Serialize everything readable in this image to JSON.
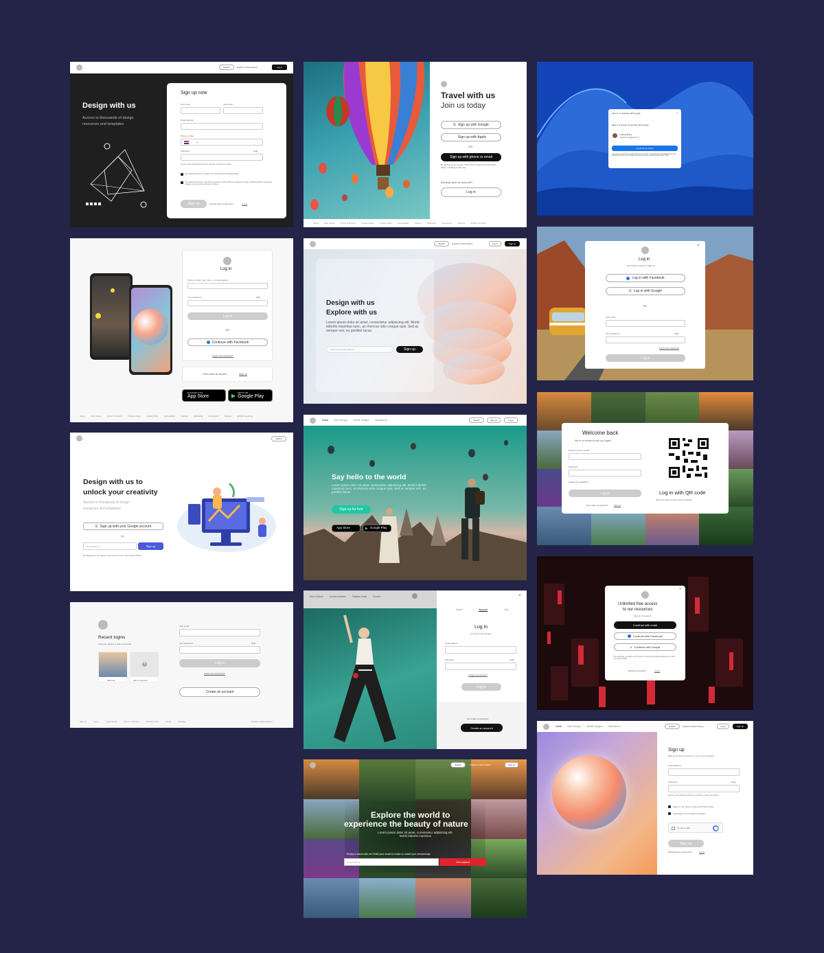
{
  "colors": {
    "page_bg": "#242448",
    "dark": "#111111",
    "accent_red": "#e0242b",
    "accent_teal": "#1ec8a5",
    "accent_blue": "#4a5ad8",
    "google_blue": "#1a73e8"
  },
  "c1": {
    "search": "Search",
    "lang": "English (United States)",
    "login": "Log in",
    "hero": "Design with us",
    "sub1": "Access to thousands of design",
    "sub2": "resources and templates",
    "form_title": "Sign up now",
    "first": "First name",
    "last": "Last name",
    "email": "Email address",
    "phone": "Phone number",
    "code": "+1",
    "password": "Password",
    "hide": "Hide",
    "hint": "Use 8 or more characters with a mix of letters, numbers & symbols",
    "agree1": "By creating an account, I agree to our Terms of use and Privacy Policy",
    "agree2": "By creating an account, I am also consenting to receive SMS messages and emails, including product new feature updates, events, and marketing promotions.",
    "signup": "Sign up",
    "already": "Already have an account?",
    "login_link": "Log in"
  },
  "c2": {
    "title1": "Travel with us",
    "title2": "Join us today",
    "google": "Sign up with Google",
    "apple": "Sign up with Apple",
    "or": "OR",
    "phone_email": "Sign up with phone or email",
    "terms": "By signing up you agree to the Terms of Service and Privacy Policy, including cookie use.",
    "already": "Already have an account?",
    "login": "Log in",
    "footer": [
      "About",
      "Help Center",
      "Terms of Service",
      "Privacy Policy",
      "Cookie Policy",
      "Accessibility",
      "Careers",
      "Marketing",
      "Developers",
      "Settings",
      "@2022 Landings"
    ]
  },
  "c3": {
    "header": "Sign in to Landings with google",
    "sub": "Sign in to design community with google",
    "name": "Ashely Bruce",
    "email": "ashely.bruce@gmail.com",
    "continue": "Continue as Ashely",
    "note": "To create your account, Google will share your name, email address, and profile picture with Design Community. See Design Community's Terms of Service and Privacy Policy."
  },
  "c4": {
    "title": "Log in",
    "field1": "Phone number, user name, or email address",
    "field2": "Your password",
    "hide": "Hide",
    "login": "Log in",
    "or": "OR",
    "facebook": "Continue with Facebook",
    "forgot": "Forget your password?",
    "noacc": "Don't have an acount?",
    "signup": "Sign up",
    "appstore_small": "Download on the",
    "appstore": "App Store",
    "play_small": "GET IT ON",
    "play": "Google Play",
    "footer": [
      "About",
      "Help Center",
      "Terms of Service",
      "Privacy Policy",
      "Cookie Policy",
      "Accessibility",
      "Careers",
      "Marketing",
      "Developers",
      "Settings",
      "@2022 Landings"
    ]
  },
  "c5": {
    "search": "Search",
    "lang": "English (United States)",
    "login": "Log in",
    "signup": "Sign up",
    "title1": "Design with us",
    "title2": "Explore with us",
    "body": "Lorem ipsum dolor sit amet, consectetur adipiscing elit. Morbi lobortis maximus nunc, ac rhoncus odio congue quis. Sed ac semper orci, eu porttitor lacus.",
    "email_ph": "Enter your email address",
    "cta": "Sign up"
  },
  "c6": {
    "title": "Log in",
    "sub": "Don't have an acount? Sign up",
    "facebook": "Log in with Facebook",
    "google": "Log in with Google",
    "or": "OR",
    "email": "Your email",
    "password": "Your password",
    "hide": "Hide",
    "forgot": "Forget your password",
    "login": "Log in"
  },
  "c7": {
    "title": "Design with us to",
    "title2": "unlock your creativity",
    "sub1": "Access to thousands of design",
    "sub2": "resources and templates",
    "google": "Sign up with your Google account",
    "or": "OR",
    "email_ph": "Email address",
    "signup": "Sign up",
    "terms": "By signing up, you agree to the Terms of use and Privacy Policy",
    "search": "Search"
  },
  "c8": {
    "nav": [
      "Home",
      "Web designs",
      "Mobile designs",
      "Illustrations"
    ],
    "search": "Search",
    "signup": "Sign up",
    "login": "Log in",
    "hero": "Say hello to the world",
    "body": "Lorem ipsum dolor sit amet, consectetur adipiscing elit. Morbi lobortis maximus nunc, ac rhoncus odio congue quis. Sed ac semper orci, eu porttitor lacus.",
    "cta": "Sign up for free",
    "appstore": "App Store",
    "play": "Google Play"
  },
  "c9": {
    "title": "Welcome back",
    "sub": "We're so excited to see you again!",
    "email": "Email or phone number",
    "password": "Password",
    "forgot": "Forget your password",
    "login": "Log in",
    "noacc": "Don't have an account?",
    "signup": "Sign up",
    "qr_title": "Log in with QR code",
    "qr_sub": "Scan this with our app to log in instantly."
  },
  "c10": {
    "title": "Recent logins",
    "sub": "Click your picture or add an account",
    "user": "Mila Lee",
    "add": "Add an account",
    "email": "Your email",
    "password": "Your password",
    "hide": "Hide",
    "login": "Log in",
    "forgot": "Forget your password?",
    "create": "Create an account",
    "footer": [
      "Sign up",
      "Log in",
      "Help Center",
      "Terms of Service",
      "Privacy Policy",
      "About",
      "Settings"
    ],
    "lang": "English (United States)"
  },
  "c11": {
    "nav": [
      "Men Clothes",
      "Women clothes",
      "Fashion show",
      "Events"
    ],
    "tabs": [
      "Home",
      "Account",
      "Cart"
    ],
    "title": "Log in",
    "sub": "to access your account",
    "email": "Email address",
    "password": "Password",
    "hide": "Hide",
    "forgot": "I forget my password",
    "login": "Log in",
    "noacc": "Don't have an account?",
    "create": "Create an account"
  },
  "c12": {
    "title": "Unlimited free access",
    "title2": "to our resources",
    "sub": "Sign up in seconds",
    "email": "Continue with email",
    "facebook": "Continue with Facebook",
    "google": "Continue with Google",
    "terms": "By continuing, you agree to the Terms of Services and acknowledge you've read our Privacy Policy",
    "member": "Already a member?",
    "login": "Log in"
  },
  "c13": {
    "search": "Search",
    "lang": "English (United States)",
    "signup": "Sign up",
    "title1": "Explore the world to",
    "title2": "experience the beauty of nature",
    "body": "Lorem ipsum dolor sit amet, consectetur adipiscing elit. Morbi lobortis maximus",
    "ready": "Ready to travel with us? Enter your email to create or restart your membership.",
    "email_ph": "Email address",
    "cta": "Get started"
  },
  "c14": {
    "nav": [
      "Home",
      "Web designs",
      "Mobile designs",
      "Illustrations"
    ],
    "search": "Search",
    "lang": "English (United States)",
    "login": "Log in",
    "signup": "Sign up",
    "title": "Sign up",
    "sub": "Sign up for free to access to in any of our products",
    "email": "Email address",
    "password": "Password",
    "hide": "Hide",
    "hint": "Use 8 or more characters with a mix of letters, numbers & symbols",
    "agree1": "Agree to our Terms of use and Privacy Policy",
    "agree2": "Subscribe to our monthly newsletter",
    "captcha": "I'm not a robot",
    "cta": "Sign up",
    "already": "Already have an account?",
    "login_link": "Log in"
  }
}
